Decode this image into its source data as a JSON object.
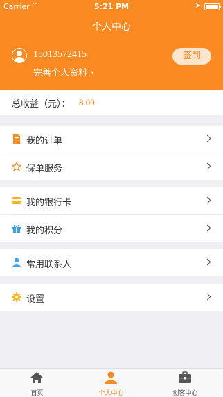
{
  "status_bar": {
    "carrier": "Carrier",
    "time": "5:21 PM"
  },
  "header": {
    "title": "个人中心",
    "phone": "15013572415",
    "profile_link": "完善个人资料 ›",
    "signin_label": "签到"
  },
  "earnings": {
    "label": "总收益（元）：",
    "value": "8.09"
  },
  "menu": [
    {
      "label": "我的订单",
      "icon": "document-icon"
    },
    {
      "label": "保单服务",
      "icon": "star-icon"
    },
    {
      "label": "我的银行卡",
      "icon": "card-icon"
    },
    {
      "label": "我的积分",
      "icon": "gift-icon"
    },
    {
      "label": "常用联系人",
      "icon": "person-icon"
    },
    {
      "label": "设置",
      "icon": "gear-icon"
    }
  ],
  "tabs": [
    {
      "label": "首页",
      "icon": "home-icon"
    },
    {
      "label": "个人中心",
      "icon": "person-icon",
      "active": true
    },
    {
      "label": "创客中心",
      "icon": "briefcase-icon"
    }
  ],
  "colors": {
    "accent": "#fb8a22",
    "background": "#efeff4"
  }
}
